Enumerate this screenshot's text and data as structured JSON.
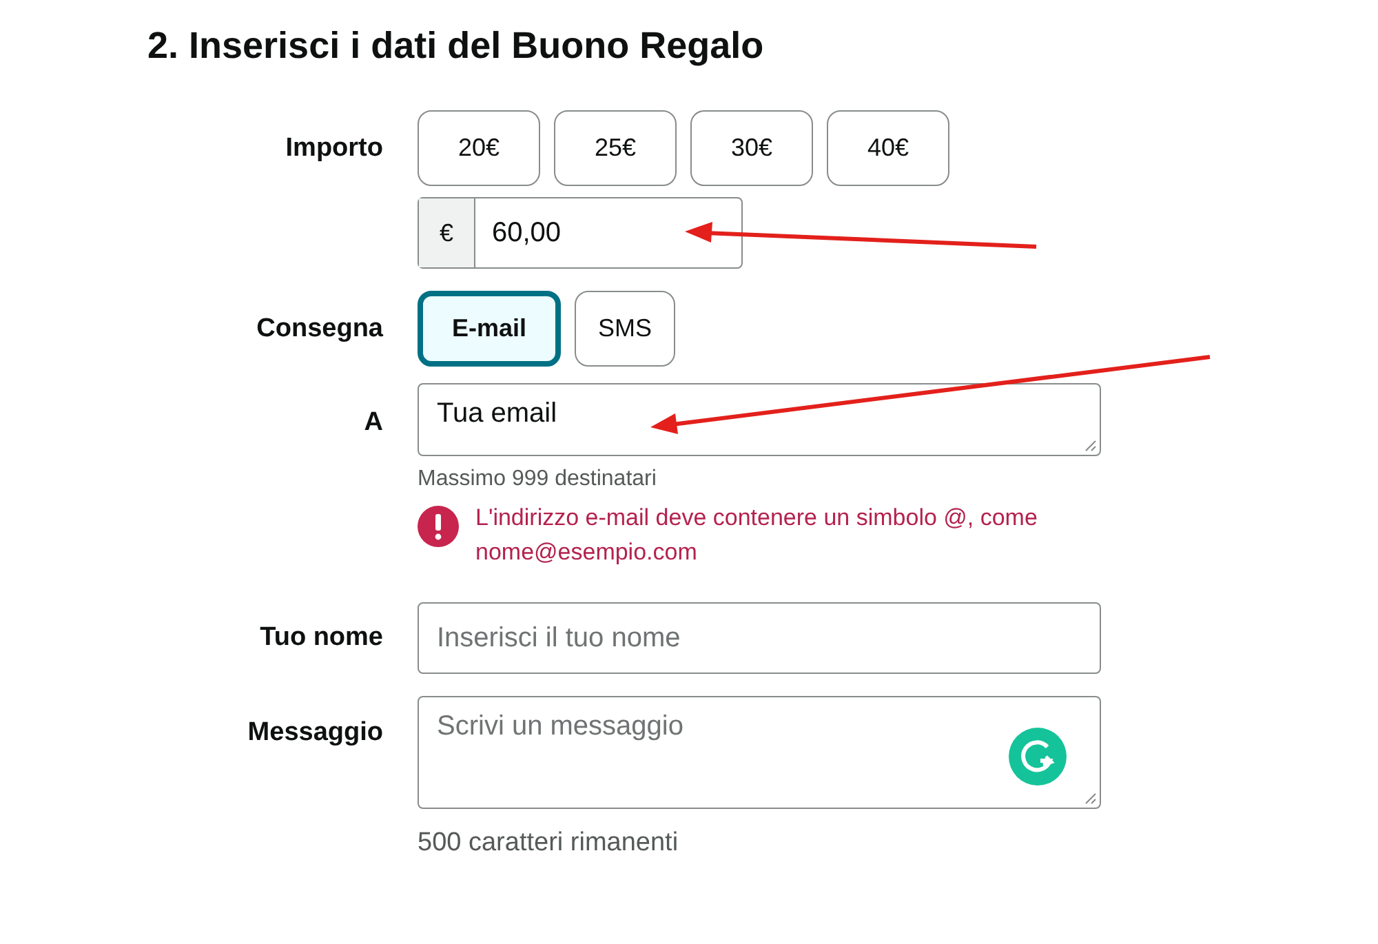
{
  "heading": "2. Inserisci i dati del Buono Regalo",
  "amount": {
    "label": "Importo",
    "presets": [
      {
        "label": "20€",
        "selected": false
      },
      {
        "label": "25€",
        "selected": false
      },
      {
        "label": "30€",
        "selected": false
      },
      {
        "label": "40€",
        "selected": false
      }
    ],
    "currency": "€",
    "value": "60,00"
  },
  "delivery": {
    "label": "Consegna",
    "options": [
      {
        "label": "E-mail",
        "selected": true
      },
      {
        "label": "SMS",
        "selected": false
      }
    ]
  },
  "recipient": {
    "label": "A",
    "value": "Tua email",
    "hint": "Massimo 999 destinatari",
    "error": "L'indirizzo e-mail deve contenere un simbolo @, come nome@esempio.com"
  },
  "name": {
    "label": "Tuo nome",
    "placeholder": "Inserisci il tuo nome"
  },
  "message": {
    "label": "Messaggio",
    "placeholder": "Scrivi un messaggio",
    "counter": "500 caratteri rimanenti"
  }
}
